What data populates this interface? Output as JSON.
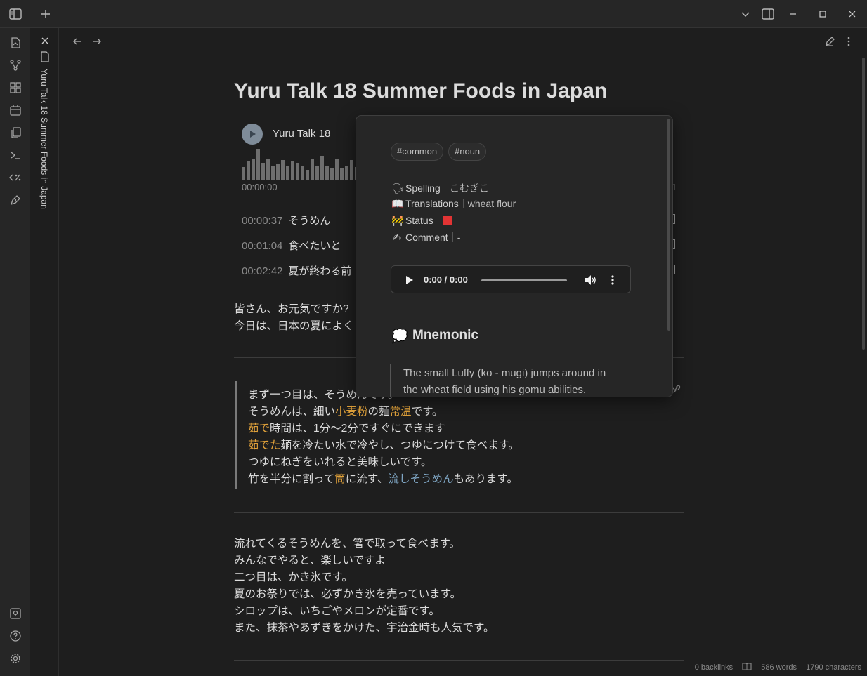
{
  "note": {
    "title": "Yuru Talk 18 Summer Foods in Japan",
    "tab_label": "Yuru Talk 18 Summer Foods in Japan"
  },
  "player": {
    "title": "Yuru Talk 18",
    "current_time": "00:00:00",
    "end_fragment": "1"
  },
  "cues": [
    {
      "time": "00:00:37",
      "text": "そうめん"
    },
    {
      "time": "00:01:04",
      "text": "食べたいと"
    },
    {
      "time": "00:02:42",
      "text": "夏が終わる前"
    }
  ],
  "intro": {
    "line1": "皆さん、お元気ですか?",
    "line2": "今日は、日本の夏によく"
  },
  "quote": {
    "l1": "まず一つ目は、そうめんです。",
    "l2_a": "そうめんは、細い",
    "l2_b": "小麦粉",
    "l2_c": "の麺",
    "l2_d": "常温",
    "l2_e": "です。",
    "l3_a": "茹で",
    "l3_b": "時間は、1分〜2分ですぐにできます",
    "l4_a": "茹でた",
    "l4_b": "麺を冷たい水で冷やし、つゆにつけて食べます。",
    "l5": "つゆにねぎをいれると美味しいです。",
    "l6_a": "竹を半分に割って",
    "l6_b": "筒",
    "l6_c": "に流す、",
    "l6_d": "流しそうめん",
    "l6_e": "もあります。"
  },
  "para2": [
    "流れてくるそうめんを、箸で取って食べます。",
    "みんなでやると、楽しいですよ",
    "二つ目は、かき氷です。",
    "夏のお祭りでは、必ずかき氷を売っています。",
    "シロップは、いちごやメロンが定番です。",
    "また、抹茶やあずきをかけた、宇治金時も人気です。"
  ],
  "status_bar": {
    "backlinks": "0 backlinks",
    "words": "586 words",
    "characters": "1790 characters"
  },
  "popover": {
    "tags": [
      "#common",
      "#noun"
    ],
    "props": [
      {
        "icon": "🗣",
        "key": "Spelling",
        "value": "こむぎこ"
      },
      {
        "icon": "📖",
        "key": "Translations",
        "value": "wheat flour"
      },
      {
        "icon": "🚧",
        "key": "Status",
        "value": ""
      },
      {
        "icon": "✍",
        "key": "Comment",
        "value": "-"
      }
    ],
    "status_color": "#e23434",
    "audio_time": "0:00 / 0:00",
    "heading_icon": "💭",
    "heading": "Mnemonic",
    "mnemonic_line1": "The small Luffy (ko - mugi) jumps around in",
    "mnemonic_line2": "the wheat field using his gomu abilities."
  },
  "colors": {
    "background": "#1e1e1e",
    "highlight": "#e0a13a",
    "highlight_blue": "#7fa6c4"
  }
}
